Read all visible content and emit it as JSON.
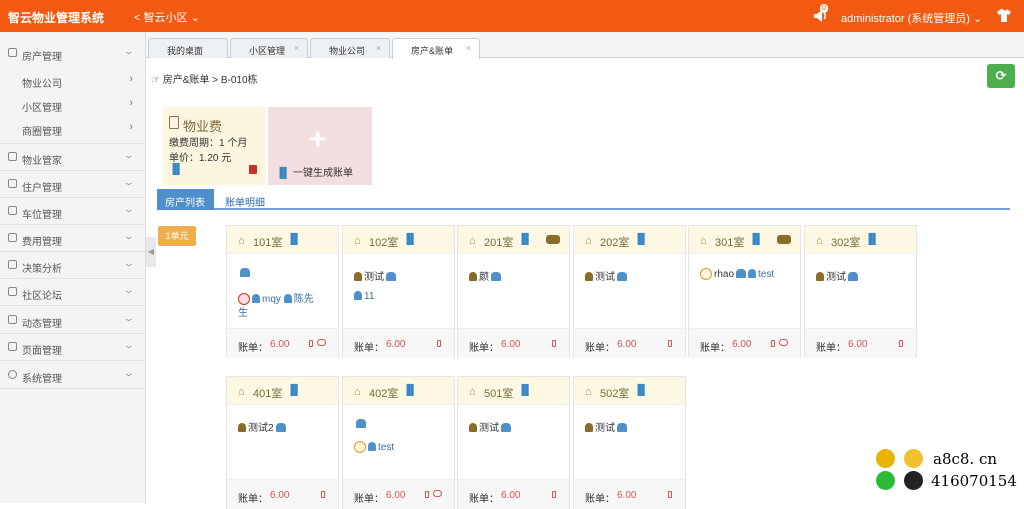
{
  "app": {
    "title": "智云物业管理系统",
    "community": "智云小区",
    "user": "administrator (系统管理员)",
    "notif_count": "0"
  },
  "sidebar": {
    "items": [
      {
        "label": "房产管理"
      },
      {
        "label": "物业公司"
      },
      {
        "label": "小区管理"
      },
      {
        "label": "商圈管理"
      },
      {
        "label": "物业管家"
      },
      {
        "label": "住户管理"
      },
      {
        "label": "车位管理"
      },
      {
        "label": "费用管理"
      },
      {
        "label": "决策分析"
      },
      {
        "label": "社区论坛"
      },
      {
        "label": "动态管理"
      },
      {
        "label": "页面管理"
      },
      {
        "label": "系统管理"
      }
    ]
  },
  "tabs": [
    "我的桌面",
    "小区管理",
    "物业公司",
    "房产&账单"
  ],
  "breadcrumb": "房产&账单 > B-010栋",
  "fee": {
    "title": "物业费",
    "period": "缴费周期：1 个月",
    "price": "单价：1.20 元"
  },
  "generate_label": "一键生成账单",
  "page_tabs": [
    "房产列表",
    "账单明细"
  ],
  "unit_tag": "1单元",
  "bill_label": "账单：",
  "rooms": [
    {
      "name": "101室",
      "bill": "6.00",
      "u1": "mqy",
      "u2": "陈先",
      "u2b": "生"
    },
    {
      "name": "102室",
      "bill": "6.00",
      "owner": "测试",
      "u1": "11"
    },
    {
      "name": "201室",
      "bill": "6.00",
      "owner": "颜"
    },
    {
      "name": "202室",
      "bill": "6.00",
      "owner": "测试"
    },
    {
      "name": "301室",
      "bill": "6.00",
      "owner": "rhao",
      "u1": "test"
    },
    {
      "name": "302室",
      "bill": "6.00",
      "owner": "测试"
    },
    {
      "name": "401室",
      "bill": "6.00",
      "owner": "测试2"
    },
    {
      "name": "402室",
      "bill": "6.00",
      "u1": "test"
    },
    {
      "name": "501室",
      "bill": "6.00",
      "owner": "测试"
    },
    {
      "name": "502室",
      "bill": "6.00",
      "owner": "测试"
    }
  ],
  "watermark": {
    "line1": "a8c8. cn",
    "line2": "416070154"
  }
}
